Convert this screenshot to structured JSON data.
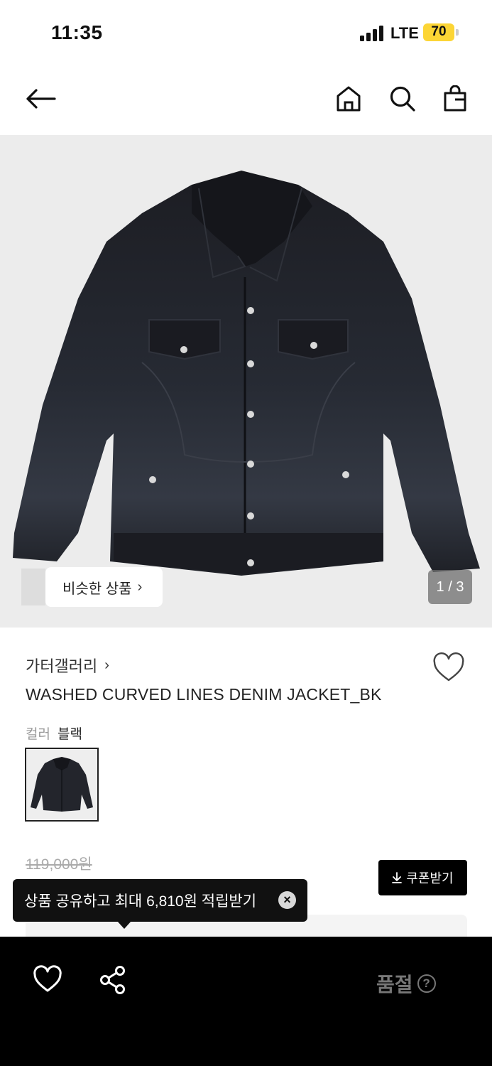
{
  "status_bar": {
    "time": "11:35",
    "network": "LTE",
    "battery": "70",
    "battery_color": "#fcd535"
  },
  "nav": {
    "icons": [
      "arrow-left-icon",
      "home-icon",
      "search-icon",
      "shopping-bag-icon"
    ]
  },
  "gallery": {
    "similar_label": "비슷한 상품",
    "page_indicator": "1 / 3",
    "background_color": "#ececec"
  },
  "product": {
    "brand": "가터갤러리",
    "name": "WASHED CURVED LINES DENIM JACKET_BK",
    "color_label": "컬러",
    "color_value": "블랙",
    "original_price": "119,000원",
    "coupon_label": "쿠폰받기"
  },
  "tooltip": {
    "text": "상품 공유하고 최대 6,810원 적립받기"
  },
  "bottom_bar": {
    "status_label": "품절",
    "help_symbol": "?"
  }
}
